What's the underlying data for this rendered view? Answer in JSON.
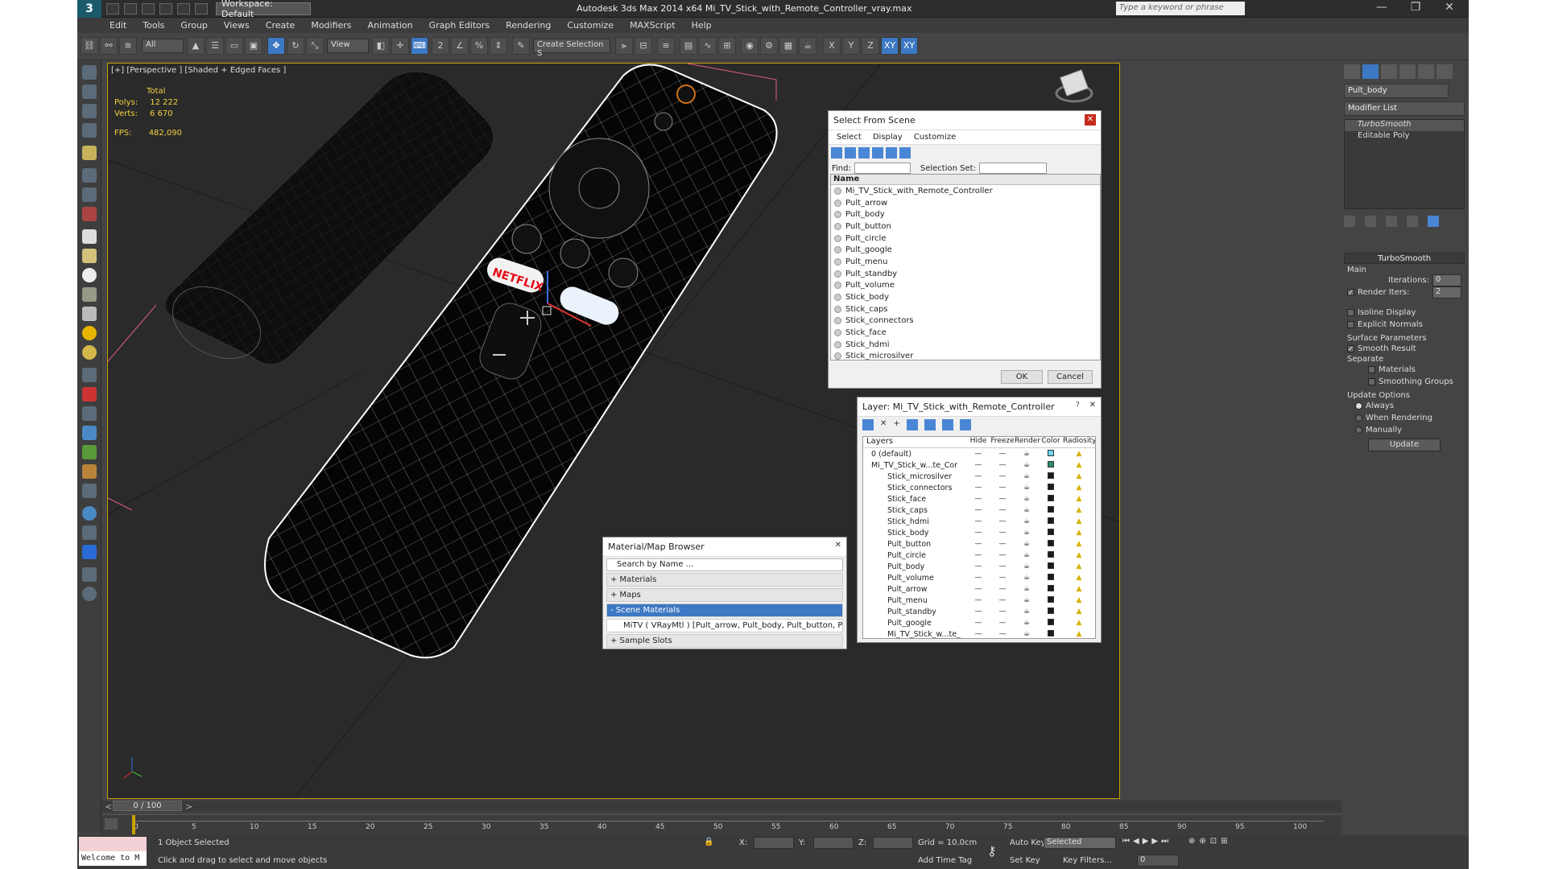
{
  "window": {
    "title": "Autodesk 3ds Max  2014 x64     Mi_TV_Stick_with_Remote_Controller_vray.max",
    "workspace": "Workspace: Default",
    "search_placeholder": "Type a keyword or phrase"
  },
  "menu": [
    "Edit",
    "Tools",
    "Group",
    "Views",
    "Create",
    "Modifiers",
    "Animation",
    "Graph Editors",
    "Rendering",
    "Customize",
    "MAXScript",
    "Help"
  ],
  "toolbar": {
    "filter": "All",
    "ref_coord": "View",
    "selection_set": "Create Selection S",
    "axes": [
      "X",
      "Y",
      "Z",
      "XY",
      "XY"
    ]
  },
  "viewport": {
    "label": "[+] [Perspective ] [Shaded + Edged Faces ]",
    "stats": {
      "header": "Total",
      "polys_label": "Polys:",
      "polys": "12 222",
      "verts_label": "Verts:",
      "verts": "6 670",
      "fps_label": "FPS:",
      "fps": "482,090"
    },
    "netflix": "NETFLIX"
  },
  "command_panel": {
    "object_name": "Pult_body",
    "modifier_list": "Modifier List",
    "stack": [
      "TurboSmooth",
      "Editable Poly"
    ],
    "rollout_title": "TurboSmooth",
    "main_label": "Main",
    "iterations_label": "Iterations:",
    "iterations": "0",
    "render_iters_label": "Render Iters:",
    "render_iters": "2",
    "isoline": "Isoline Display",
    "explicit_normals": "Explicit Normals",
    "surface_params": "Surface Parameters",
    "smooth_result": "Smooth Result",
    "separate": "Separate",
    "materials": "Materials",
    "smoothing_groups": "Smoothing Groups",
    "update_options": "Update Options",
    "always": "Always",
    "when_rendering": "When Rendering",
    "manually": "Manually",
    "update_btn": "Update"
  },
  "select_from_scene": {
    "title": "Select From Scene",
    "menu": [
      "Select",
      "Display",
      "Customize"
    ],
    "find_label": "Find:",
    "selection_set_label": "Selection Set:",
    "column": "Name",
    "items": [
      "Mi_TV_Stick_with_Remote_Controller",
      "Pult_arrow",
      "Pult_body",
      "Pult_button",
      "Pult_circle",
      "Pult_google",
      "Pult_menu",
      "Pult_standby",
      "Pult_volume",
      "Stick_body",
      "Stick_caps",
      "Stick_connectors",
      "Stick_face",
      "Stick_hdmi",
      "Stick_microsilver"
    ],
    "ok": "OK",
    "cancel": "Cancel"
  },
  "layer_dialog": {
    "title": "Layer: Mi_TV_Stick_with_Remote_Controller",
    "columns": [
      "Layers",
      "Hide",
      "Freeze",
      "Render",
      "Color",
      "Radiosity"
    ],
    "rows": [
      "0 (default)",
      "Mi_TV_Stick_w...te_Cor",
      "Stick_microsilver",
      "Stick_connectors",
      "Stick_face",
      "Stick_caps",
      "Stick_hdmi",
      "Stick_body",
      "Pult_button",
      "Pult_circle",
      "Pult_body",
      "Pult_volume",
      "Pult_arrow",
      "Pult_menu",
      "Pult_standby",
      "Pult_google",
      "Mi_TV_Stick_w...te_"
    ]
  },
  "material_browser": {
    "title": "Material/Map Browser",
    "search": "Search by Name ...",
    "groups": [
      "+ Materials",
      "+ Maps",
      "- Scene Materials"
    ],
    "material": "MiTV  ( VRayMtl ) [Pult_arrow, Pult_body, Pult_button, Pult_circle,...",
    "sample_slots": "+ Sample Slots"
  },
  "timeline": {
    "frame": "0 / 100",
    "ticks": [
      "0",
      "5",
      "10",
      "15",
      "20",
      "25",
      "30",
      "35",
      "40",
      "45",
      "50",
      "55",
      "60",
      "65",
      "70",
      "75",
      "80",
      "85",
      "90",
      "95",
      "100"
    ]
  },
  "status": {
    "maxscript": "Welcome to M",
    "selected": "1 Object Selected",
    "prompt": "Click and drag to select and move objects",
    "x_label": "X:",
    "y_label": "Y:",
    "z_label": "Z:",
    "grid": "Grid = 10,0cm",
    "add_time_tag": "Add Time Tag",
    "auto_key": "Auto Key",
    "set_key": "Set Key",
    "selected_dd": "Selected",
    "key_filters": "Key Filters...",
    "frame_field": "0"
  }
}
